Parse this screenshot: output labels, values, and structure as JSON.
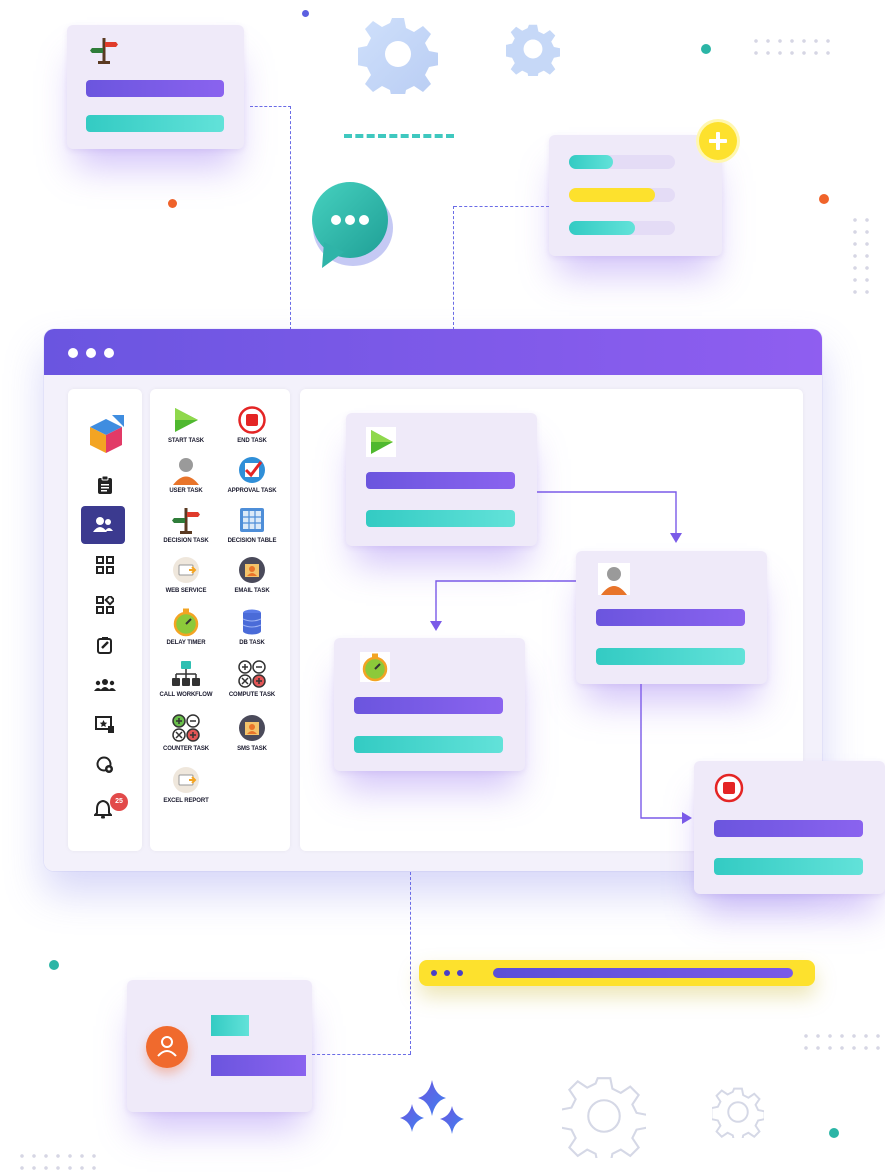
{
  "tasks": [
    {
      "label": "START TASK",
      "icon": "play-icon"
    },
    {
      "label": "END TASK",
      "icon": "stop-icon"
    },
    {
      "label": "USER TASK",
      "icon": "user-icon"
    },
    {
      "label": "APPROVAL TASK",
      "icon": "approval-check-icon"
    },
    {
      "label": "DECISION TASK",
      "icon": "signpost-icon"
    },
    {
      "label": "DECISION TABLE",
      "icon": "table-icon"
    },
    {
      "label": "WEB SERVICE",
      "icon": "web-service-icon"
    },
    {
      "label": "EMAIL TASK",
      "icon": "email-icon"
    },
    {
      "label": "DELAY TIMER",
      "icon": "stopwatch-icon"
    },
    {
      "label": "DB TASK",
      "icon": "database-icon"
    },
    {
      "label": "CALL WORKFLOW",
      "icon": "hierarchy-icon"
    },
    {
      "label": "COMPUTE TASK",
      "icon": "calculator-icon"
    },
    {
      "label": "COUNTER TASK",
      "icon": "counter-icon"
    },
    {
      "label": "SMS TASK",
      "icon": "sms-icon"
    },
    {
      "label": "EXCEL REPORT",
      "icon": "excel-report-icon"
    }
  ],
  "sidebar": {
    "notification_count": "25",
    "icons": [
      "logo-cube-icon",
      "clipboard-icon",
      "user-group-icon",
      "grid-icon",
      "grid-settings-icon",
      "edit-icon",
      "team-icon",
      "presentation-star-icon",
      "shield-settings-icon",
      "bell-icon"
    ]
  },
  "colors": {
    "accent_purple": "#7a5ae8",
    "accent_teal": "#3fd3c9",
    "accent_yellow": "#fde12d",
    "stop_red": "#e42525",
    "orange": "#f06a2d"
  }
}
